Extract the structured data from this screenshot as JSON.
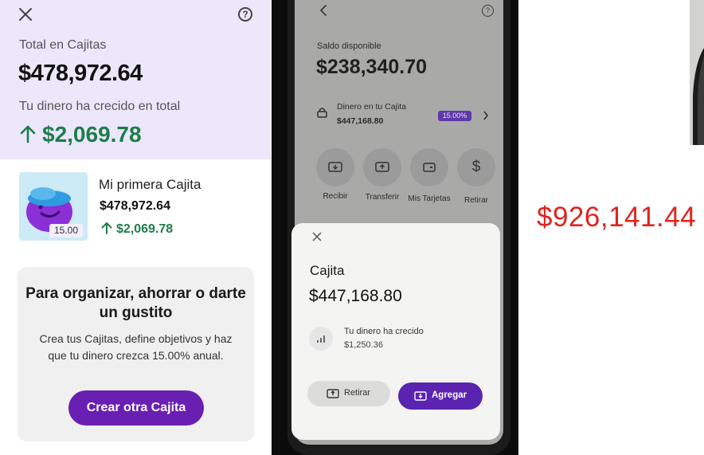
{
  "left_panel": {
    "total_label": "Total en Cajitas",
    "total_amount": "$478,972.64",
    "growth_label": "Tu dinero ha crecido en total",
    "growth_amount": "$2,069.78",
    "cajita": {
      "name": "Mi primera Cajita",
      "amount": "$478,972.64",
      "growth": "$2,069.78",
      "rate_badge": "15.00"
    },
    "promo": {
      "title": "Para organizar, ahorrar o darte un gustito",
      "body": "Crea tus Cajitas, define objetivos y haz que tu dinero crezca 15.00% anual.",
      "button_label": "Crear otra Cajita"
    }
  },
  "phone": {
    "balance_label": "Saldo disponible",
    "balance_amount": "$238,340.70",
    "cajita_row_label": "Dinero en tu Cajita",
    "cajita_row_amount": "$447,168.80",
    "cajita_row_badge": "15.00%",
    "quick_actions": [
      {
        "label": "Recibir",
        "icon": "receive-icon"
      },
      {
        "label": "Transferir",
        "icon": "transfer-icon"
      },
      {
        "label": "Mis Tarjetas",
        "icon": "cards-icon"
      },
      {
        "label": "Retirar",
        "icon": "dollar-icon"
      }
    ],
    "sheet": {
      "title": "Cajita",
      "amount": "$447,168.80",
      "growth_label": "Tu dinero ha crecido",
      "growth_amount": "$1,250.36",
      "retirar_label": "Retirar",
      "agregar_label": "Agregar"
    }
  },
  "overlay_total": "$926,141.44",
  "colors": {
    "accent_purple": "#6a1fb3",
    "growth_green": "#1d7d4a",
    "total_red": "#e0231f",
    "header_lavender": "#ece7fb"
  }
}
